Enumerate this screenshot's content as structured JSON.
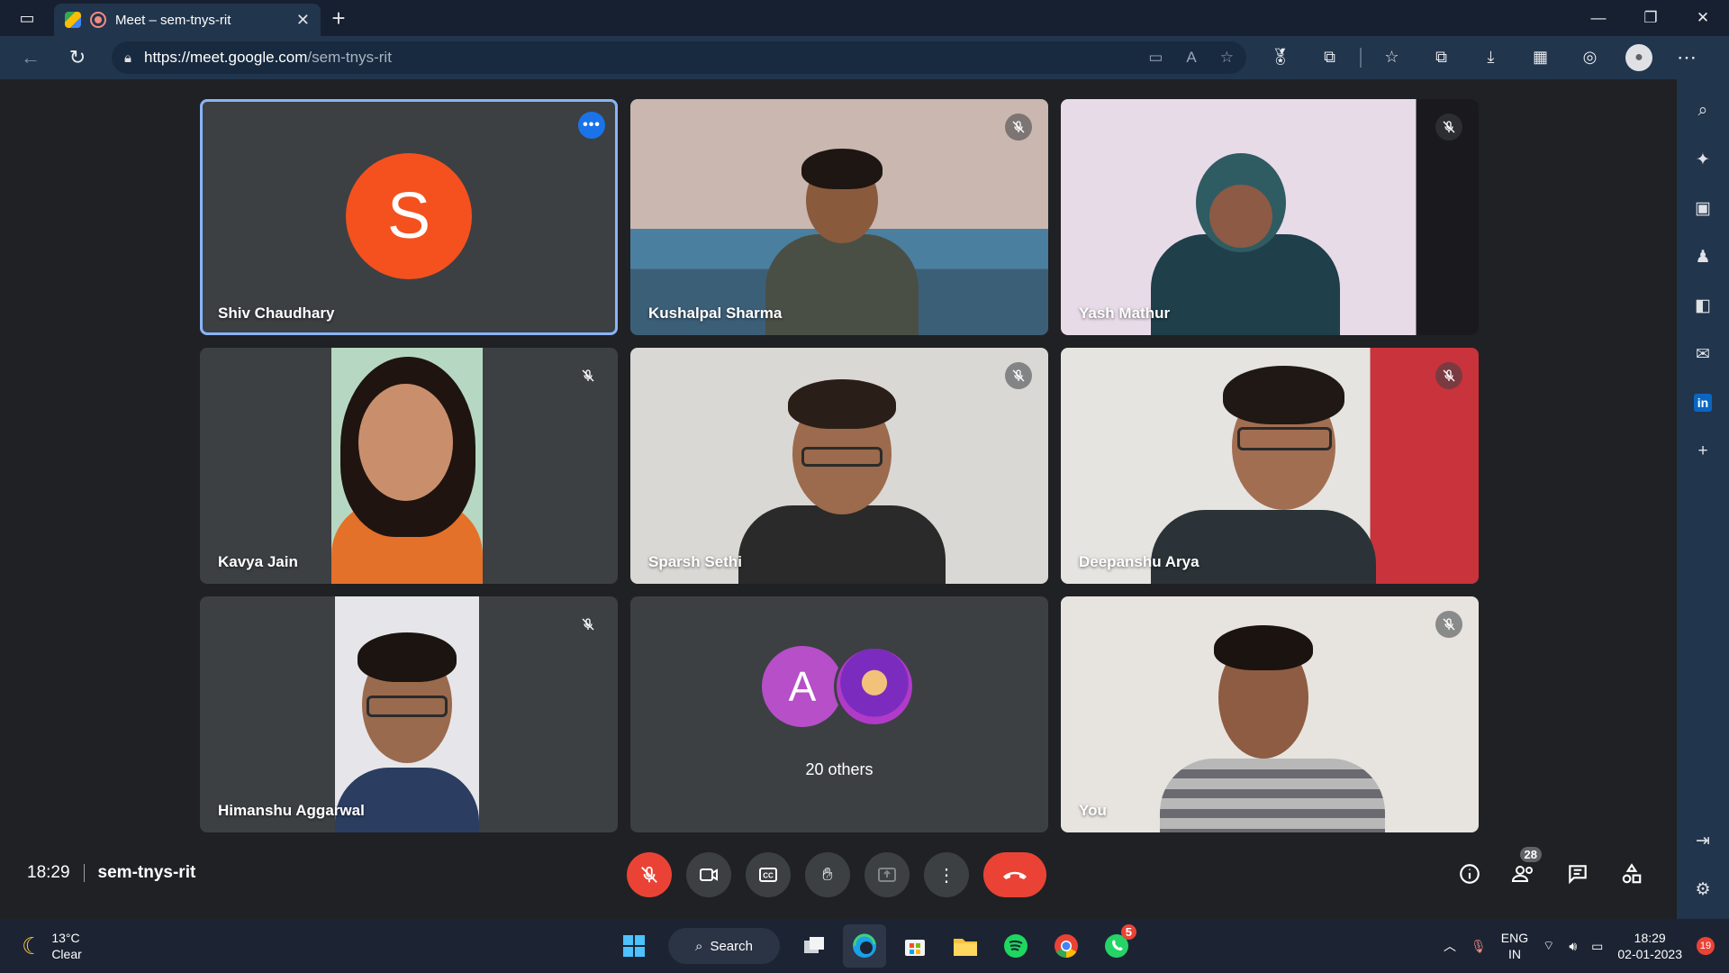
{
  "browser": {
    "tab_title": "Meet – sem-tnys-rit",
    "url_host": "https://meet.google.com",
    "url_path": "/sem-tnys-rit"
  },
  "tiles": [
    {
      "name": "Shiv Chaudhary",
      "avatar_letter": "S",
      "color": "#f4511e"
    },
    {
      "name": "Kushalpal Sharma"
    },
    {
      "name": "Yash Mathur"
    },
    {
      "name": "Kavya Jain"
    },
    {
      "name": "Sparsh Sethi"
    },
    {
      "name": "Deepanshu Arya"
    },
    {
      "name": "Himanshu Aggarwal"
    },
    {
      "name": "20 others",
      "avatar_letter": "A"
    },
    {
      "name": "You"
    }
  ],
  "meeting": {
    "time": "18:29",
    "code": "sem-tnys-rit",
    "participant_count": "28"
  },
  "taskbar": {
    "temperature": "13°C",
    "weather": "Clear",
    "search_label": "Search",
    "whatsapp_badge": "5",
    "lang_line1": "ENG",
    "lang_line2": "IN",
    "clock_time": "18:29",
    "clock_date": "02-01-2023",
    "notification_count": "19"
  },
  "colors": {
    "accent": "#8ab4f8",
    "danger": "#ea4335",
    "tile_bg": "#3c4043",
    "stage_bg": "#202124"
  }
}
